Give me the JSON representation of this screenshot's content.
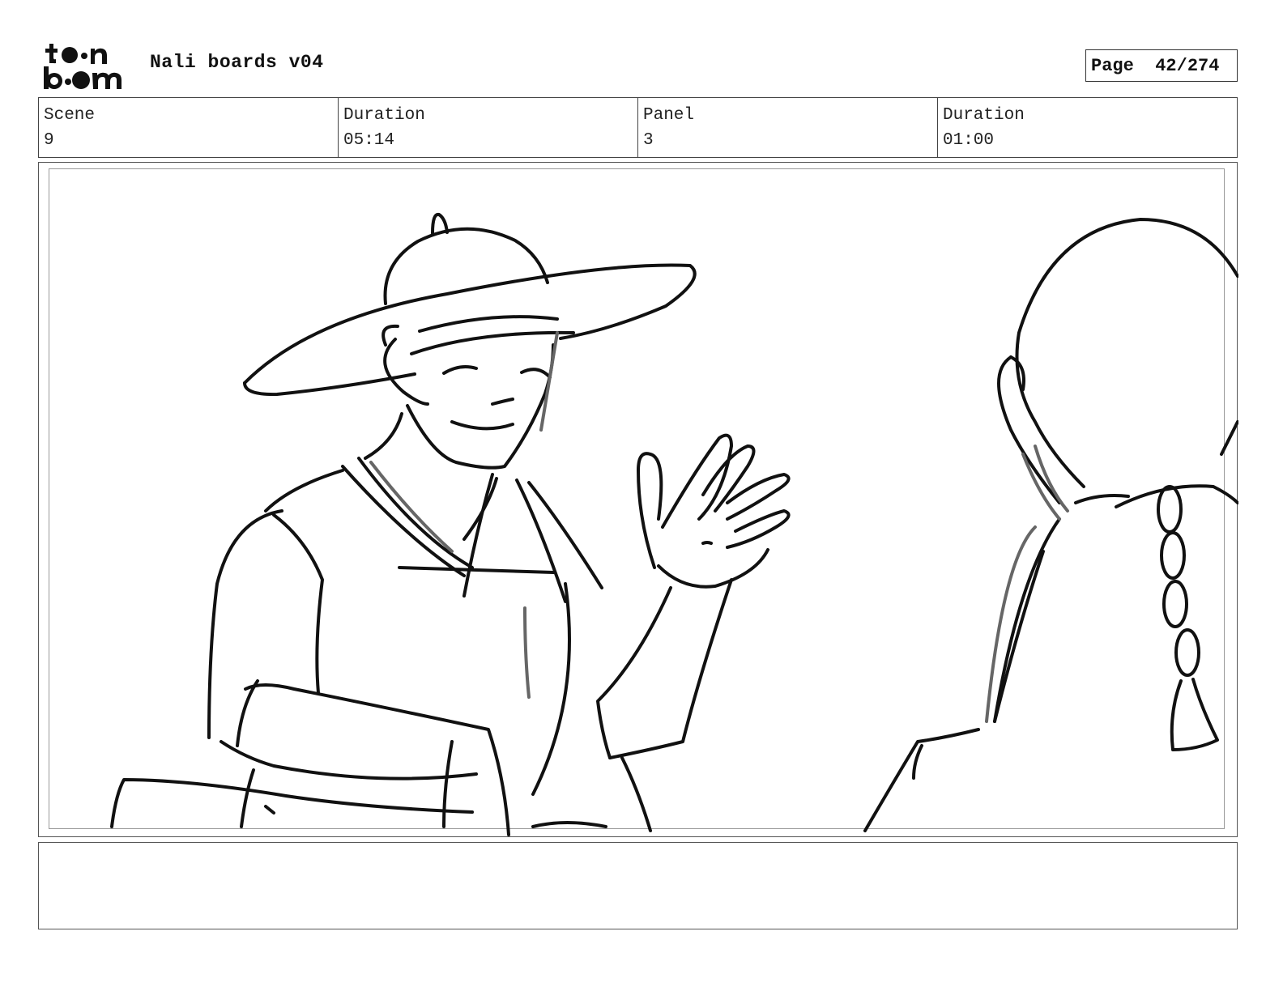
{
  "header": {
    "logo_text": "toonboom",
    "project_title": "Nali boards v04",
    "page_label": "Page",
    "page_number": "42/274"
  },
  "info": {
    "scene_label": "Scene",
    "scene_value": "9",
    "scene_duration_label": "Duration",
    "scene_duration_value": "05:14",
    "panel_label": "Panel",
    "panel_value": "3",
    "panel_duration_label": "Duration",
    "panel_duration_value": "01:00"
  },
  "panel": {
    "image_description": "",
    "dialog": ""
  }
}
